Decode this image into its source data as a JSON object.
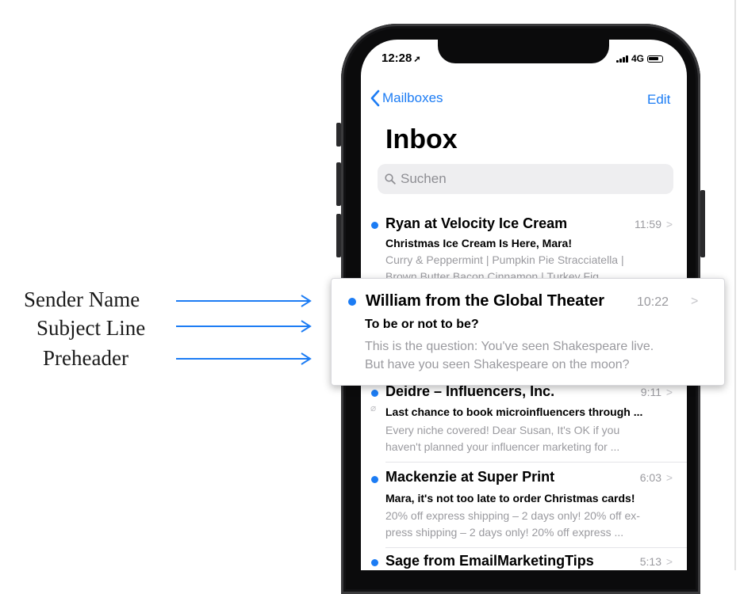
{
  "annotations": {
    "sender_name": "Sender Name",
    "subject_line": "Subject Line",
    "preheader": "Preheader"
  },
  "status_bar": {
    "time": "12:28",
    "location_glyph": "➚",
    "network": "4G"
  },
  "nav": {
    "back_label": "Mailboxes",
    "edit_label": "Edit"
  },
  "title": "Inbox",
  "search": {
    "placeholder": "Suchen"
  },
  "emails": [
    {
      "sender": "Ryan at Velocity Ice Cream",
      "time": "11:59",
      "subject": "Christmas Ice Cream Is Here, Mara!",
      "preheader_line1": "Curry & Peppermint | Pumpkin Pie Stracciatella |",
      "preheader_line2": "Brown Butter Bacon Cinnamon | Turkey Fig"
    },
    {
      "sender": "William from the Global Theater",
      "time": "10:22",
      "subject": "To be or not to be?",
      "preheader_line1": "This is the question: You've seen Shakespeare live.",
      "preheader_line2": "But have you seen Shakespeare on the moon?"
    },
    {
      "sender": "Deidre – Influencers, Inc.",
      "time": "9:11",
      "subject": "Last chance to book microinfluencers through ...",
      "preheader_line1": "Every niche covered! Dear Susan, It's OK if you",
      "preheader_line2": "haven't planned your influencer marketing for ..."
    },
    {
      "sender": "Mackenzie at Super Print",
      "time": "6:03",
      "subject": "Mara, it's not too late to order Christmas cards!",
      "preheader_line1": "20% off express shipping – 2 days only! 20% off ex-",
      "preheader_line2": "press shipping – 2 days only! 20% off express ..."
    },
    {
      "sender": "Sage from EmailMarketingTips",
      "time": "5:13"
    }
  ],
  "chevron_glyph": ">",
  "colors": {
    "accent": "#1c7cf4",
    "unread_dot": "#1c7cf4",
    "secondary_text": "#9a9a9f",
    "arrow": "#1c7cf4"
  },
  "icons": {
    "back": "chevron-left-icon",
    "search": "magnifier-icon",
    "attachment": "paperclip-icon",
    "arrow": "right-arrow-icon"
  }
}
